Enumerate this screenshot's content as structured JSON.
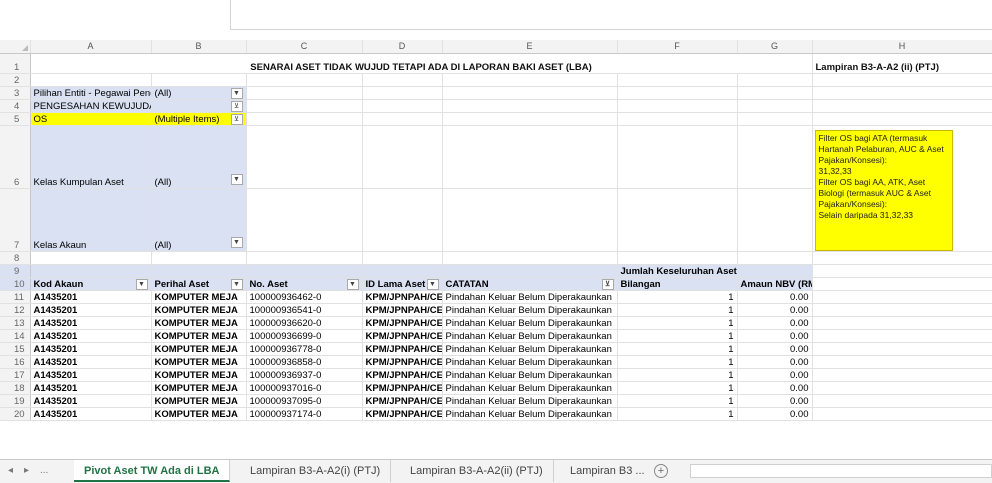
{
  "columns": [
    "A",
    "B",
    "C",
    "D",
    "E",
    "F",
    "G",
    "H"
  ],
  "title": "SENARAI ASET TIDAK WUJUD TETAPI ADA DI LAPORAN BAKI ASET (LBA)",
  "title_right": "Lampiran B3-A-A2 (ii) (PTJ)",
  "filters": [
    {
      "label": "Pilihan Entiti - Pegawai Peng",
      "value": "(All)",
      "icon": "dropdown-icon"
    },
    {
      "label": "PENGESAHAN KEWUJUDAN TW",
      "value": "",
      "icon": "filter-icon"
    },
    {
      "label": "OS",
      "value": "(Multiple Items)",
      "icon": "filter-icon"
    },
    {
      "label": "Kelas Kumpulan Aset",
      "value": "(All)",
      "icon": "dropdown-icon"
    },
    {
      "label": "Kelas Akaun",
      "value": "(All)",
      "icon": "dropdown-icon"
    }
  ],
  "note": {
    "line1": "Filter OS bagi ATA (termasuk Hartanah Pelaburan, AUC & Aset Pajakan/Konsesi):",
    "line2": "31,32,33",
    "line3": "Filter OS bagi AA, ATK, Aset Biologi (termasuk AUC & Aset Pajakan/Konsesi):",
    "line4": "Selain daripada 31,32,33"
  },
  "values_header": "Jumlah Keseluruhan Aset",
  "table_headers": {
    "kod": "Kod Akaun",
    "perihal": "Perihal Aset",
    "no_aset": "No. Aset",
    "id_lama": "ID Lama Aset",
    "catatan": "CATATAN",
    "bilangan": "Bilangan",
    "amaun": "Amaun NBV (RM)"
  },
  "rows": [
    {
      "row": "11",
      "kod": "A1435201",
      "perihal": "KOMPUTER MEJA",
      "no_aset": "100000936462-0",
      "id_lama": "KPM/JPNPAH/CE",
      "catatan": "Pindahan Keluar Belum Diperakaunkan",
      "bilangan": "1",
      "amaun": "0.00"
    },
    {
      "row": "12",
      "kod": "A1435201",
      "perihal": "KOMPUTER MEJA",
      "no_aset": "100000936541-0",
      "id_lama": "KPM/JPNPAH/CE",
      "catatan": "Pindahan Keluar Belum Diperakaunkan",
      "bilangan": "1",
      "amaun": "0.00"
    },
    {
      "row": "13",
      "kod": "A1435201",
      "perihal": "KOMPUTER MEJA",
      "no_aset": "100000936620-0",
      "id_lama": "KPM/JPNPAH/CE",
      "catatan": "Pindahan Keluar Belum Diperakaunkan",
      "bilangan": "1",
      "amaun": "0.00"
    },
    {
      "row": "14",
      "kod": "A1435201",
      "perihal": "KOMPUTER MEJA",
      "no_aset": "100000936699-0",
      "id_lama": "KPM/JPNPAH/CE",
      "catatan": "Pindahan Keluar Belum Diperakaunkan",
      "bilangan": "1",
      "amaun": "0.00"
    },
    {
      "row": "15",
      "kod": "A1435201",
      "perihal": "KOMPUTER MEJA",
      "no_aset": "100000936778-0",
      "id_lama": "KPM/JPNPAH/CE",
      "catatan": "Pindahan Keluar Belum Diperakaunkan",
      "bilangan": "1",
      "amaun": "0.00"
    },
    {
      "row": "16",
      "kod": "A1435201",
      "perihal": "KOMPUTER MEJA",
      "no_aset": "100000936858-0",
      "id_lama": "KPM/JPNPAH/CE",
      "catatan": "Pindahan Keluar Belum Diperakaunkan",
      "bilangan": "1",
      "amaun": "0.00"
    },
    {
      "row": "17",
      "kod": "A1435201",
      "perihal": "KOMPUTER MEJA",
      "no_aset": "100000936937-0",
      "id_lama": "KPM/JPNPAH/CE",
      "catatan": "Pindahan Keluar Belum Diperakaunkan",
      "bilangan": "1",
      "amaun": "0.00"
    },
    {
      "row": "18",
      "kod": "A1435201",
      "perihal": "KOMPUTER MEJA",
      "no_aset": "100000937016-0",
      "id_lama": "KPM/JPNPAH/CE",
      "catatan": "Pindahan Keluar Belum Diperakaunkan",
      "bilangan": "1",
      "amaun": "0.00"
    },
    {
      "row": "19",
      "kod": "A1435201",
      "perihal": "KOMPUTER MEJA",
      "no_aset": "100000937095-0",
      "id_lama": "KPM/JPNPAH/CE",
      "catatan": "Pindahan Keluar Belum Diperakaunkan",
      "bilangan": "1",
      "amaun": "0.00"
    },
    {
      "row": "20",
      "kod": "A1435201",
      "perihal": "KOMPUTER MEJA",
      "no_aset": "100000937174-0",
      "id_lama": "KPM/JPNPAH/CE",
      "catatan": "Pindahan Keluar Belum Diperakaunkan",
      "bilangan": "1",
      "amaun": "0.00"
    }
  ],
  "tabs": {
    "nav_prev": "◂",
    "nav_next": "▸",
    "ellipsis": "...",
    "active": "Pivot Aset TW Ada di LBA",
    "tab2": "Lampiran B3-A-A2(i) (PTJ)",
    "tab3": "Lampiran B3-A-A2(ii) (PTJ)",
    "tab4": "Lampiran B3 ...",
    "add": "+"
  },
  "colors": {
    "filter_bg": "#d9e1f2",
    "highlight": "#ffff00",
    "active_tab": "#217346"
  }
}
